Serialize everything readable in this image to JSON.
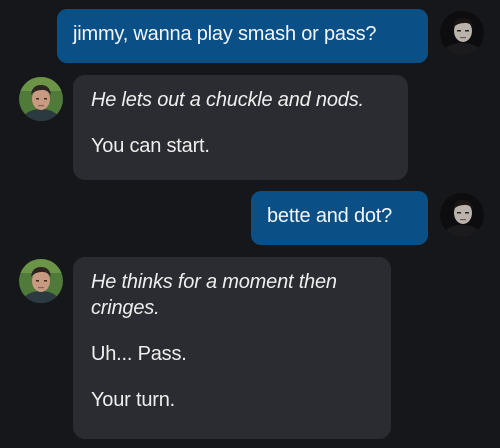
{
  "conversation": {
    "messages": [
      {
        "sender": "user",
        "avatar_icon": "user-avatar-icon",
        "text": "jimmy, wanna play smash or pass?"
      },
      {
        "sender": "character",
        "avatar_icon": "character-avatar-icon",
        "action": "He lets out a chuckle and nods.",
        "lines": [
          "You can start."
        ]
      },
      {
        "sender": "user",
        "avatar_icon": "user-avatar-icon",
        "text": "bette and dot?"
      },
      {
        "sender": "character",
        "avatar_icon": "character-avatar-icon",
        "action": "He thinks for a moment then\ncringes.",
        "lines": [
          "Uh... Pass.",
          "Your turn."
        ]
      }
    ]
  },
  "colors": {
    "background": "#16171b",
    "sent_bubble": "#0a4f86",
    "received_bubble": "#2b2c31",
    "text": "#eeeeee"
  }
}
